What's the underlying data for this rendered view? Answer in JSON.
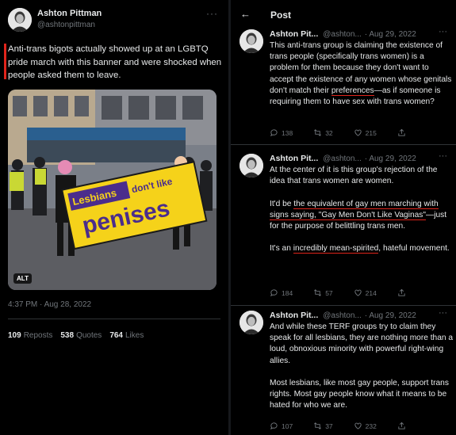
{
  "left_post": {
    "author_name": "Ashton Pittman",
    "author_handle": "@ashtonpittman",
    "more_glyph": "···",
    "text": "Anti-trans bigots actually showed up at an LGBTQ pride march with this banner and were shocked when people asked them to leave.",
    "banner_text_1": "Lesbians",
    "banner_text_2": "don't like",
    "banner_text_3": "penises",
    "alt_badge": "ALT",
    "timestamp": "4:37 PM · Aug 28, 2022",
    "reposts_count": "109",
    "reposts_label": "Reposts",
    "quotes_count": "538",
    "quotes_label": "Quotes",
    "likes_count": "764",
    "likes_label": "Likes"
  },
  "right_panel": {
    "back_glyph": "←",
    "title": "Post",
    "tweets": [
      {
        "author_name": "Ashton Pit...",
        "author_handle": "@ashton...",
        "date": "· Aug 29, 2022",
        "text_a": "This anti-trans group is claiming the existence of trans people (specifically trans women) is a problem for them because they don't want to accept the existence of any women whose genitals don't match their ",
        "text_ul": "preferences",
        "text_b": "—as if someone is requiring them to have sex with trans women?",
        "replies": "138",
        "reposts": "32",
        "likes": "215",
        "views": "",
        "more_glyph": "···"
      },
      {
        "author_name": "Ashton Pit...",
        "author_handle": "@ashton...",
        "date": "· Aug 29, 2022",
        "p1": "At the center of it is this group's rejection of the idea that trans women are women.",
        "p2_a": "It'd be ",
        "p2_ul1": "the equivalent of gay men marching with signs saying, \"Gay Men Don't Like Vaginas\"",
        "p2_b": "—just for the purpose of belittling trans men.",
        "p3_a": "It's an ",
        "p3_ul": "incredibly mean-spirited",
        "p3_b": ", hateful movement.",
        "replies": "184",
        "reposts": "57",
        "likes": "214",
        "more_glyph": "···"
      },
      {
        "author_name": "Ashton Pit...",
        "author_handle": "@ashton...",
        "date": "· Aug 29, 2022",
        "p1": "And while these TERF groups try to claim they speak for all lesbians, they are nothing more than a loud, obnoxious minority with powerful right-wing allies.",
        "p2": "Most lesbians, like most gay people, support trans rights. Most gay people know what it means to be hated for who we are.",
        "replies": "107",
        "reposts": "37",
        "likes": "232",
        "more_glyph": "···"
      }
    ]
  },
  "colors": {
    "background": "#000000",
    "text_primary": "#e7e9ea",
    "text_secondary": "#71767b",
    "annotation_red": "#e0241b",
    "banner_yellow": "#f5d21a",
    "banner_purple": "#4b2d8c"
  }
}
